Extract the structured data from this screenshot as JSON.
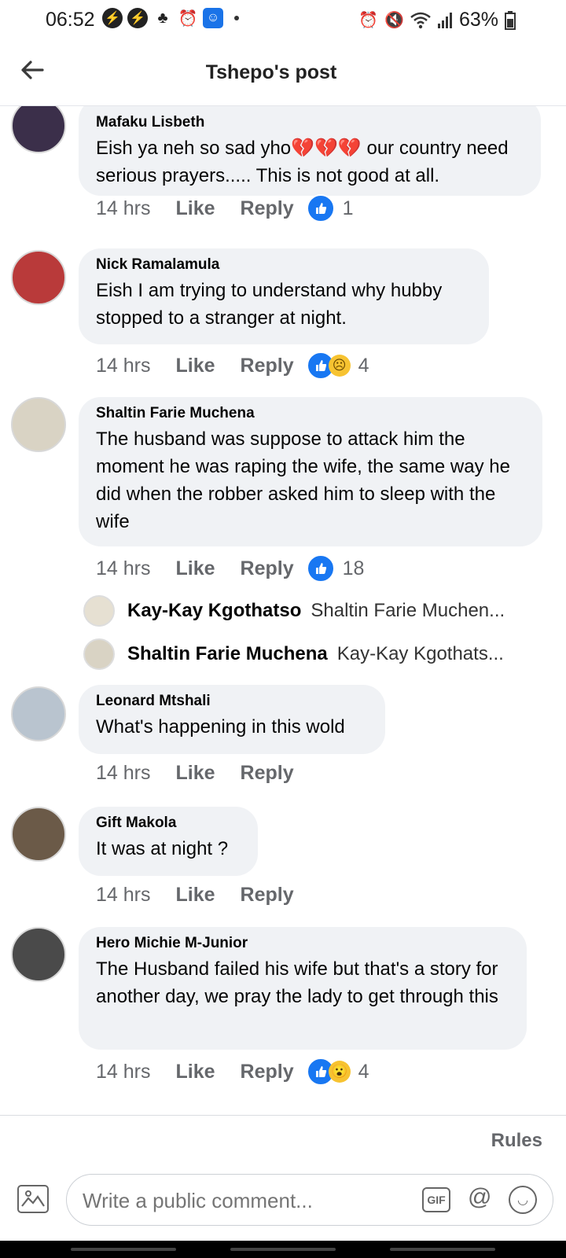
{
  "status": {
    "time": "06:52",
    "battery": "63%"
  },
  "header": {
    "title": "Tshepo's post"
  },
  "comments": [
    {
      "name": "Mafaku Lisbeth",
      "text": "Eish ya neh so sad yho💔💔💔 our country need serious prayers..... This is not good at all.",
      "time": "14 hrs",
      "like": "Like",
      "reply": "Reply",
      "reactions": [
        "like"
      ],
      "count": "1"
    },
    {
      "name": "Nick Ramalamula",
      "text": "Eish I am trying to understand why hubby stopped to a stranger at night.",
      "time": "14 hrs",
      "like": "Like",
      "reply": "Reply",
      "reactions": [
        "like",
        "sad"
      ],
      "count": "4"
    },
    {
      "name": "Shaltin Farie Muchena",
      "text": "The husband was suppose to attack him the moment he was raping the wife, the same way he did when the robber asked him to sleep with the wife",
      "time": "14 hrs",
      "like": "Like",
      "reply": "Reply",
      "reactions": [
        "like"
      ],
      "count": "18",
      "replies": [
        {
          "name": "Kay-Kay Kgothatso",
          "text": "Shaltin Farie Muchen..."
        },
        {
          "name": "Shaltin Farie Muchena",
          "text": "Kay-Kay Kgothats..."
        }
      ]
    },
    {
      "name": "Leonard Mtshali",
      "text": "What's happening in this wold",
      "time": "14 hrs",
      "like": "Like",
      "reply": "Reply"
    },
    {
      "name": "Gift Makola",
      "text": "It was at night ?",
      "time": "14 hrs",
      "like": "Like",
      "reply": "Reply"
    },
    {
      "name": "Hero Michie M-Junior",
      "text": "The Husband failed his wife but that's a story for another day,  we pray the lady to get through this",
      "time": "14 hrs",
      "like": "Like",
      "reply": "Reply",
      "reactions": [
        "like",
        "wow"
      ],
      "count": "4"
    }
  ],
  "footer": {
    "rules": "Rules",
    "placeholder": "Write a public comment...",
    "gif": "GIF"
  },
  "colors": {
    "accent": "#1877f2",
    "bubble": "#f0f2f5",
    "meta": "#65676b"
  }
}
